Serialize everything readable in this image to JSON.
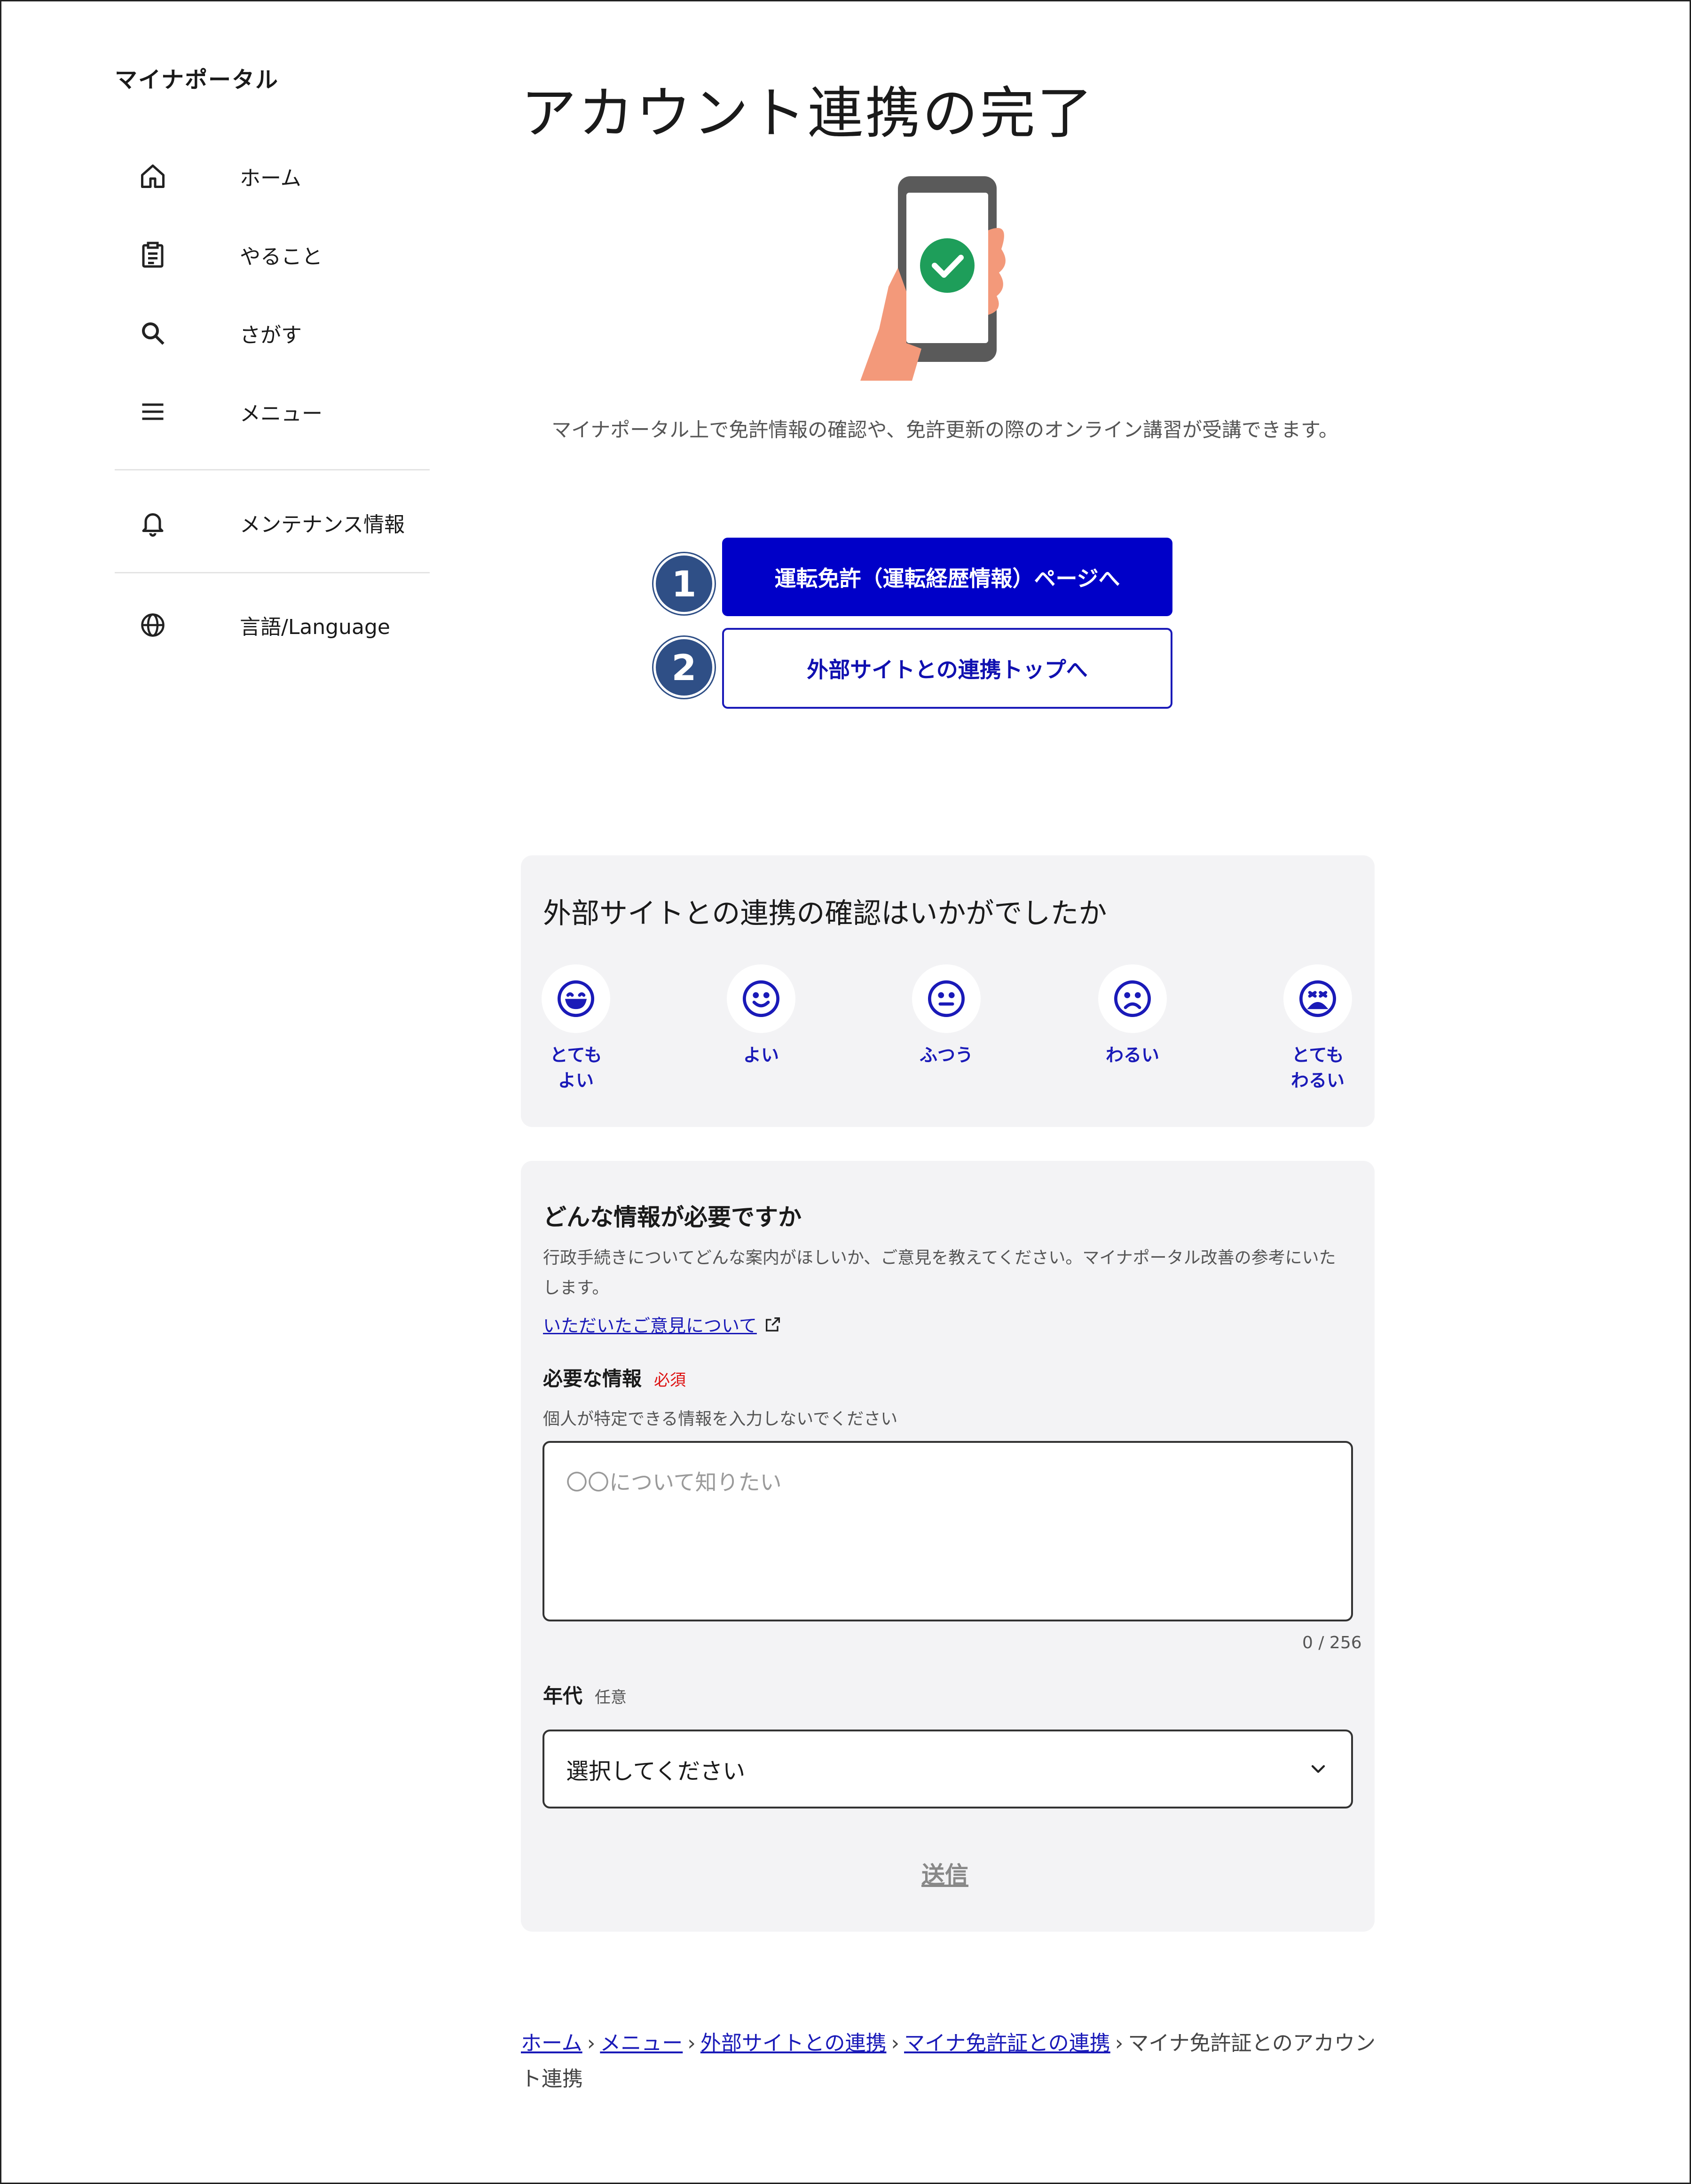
{
  "app": {
    "title": "マイナポータル"
  },
  "sidebar": {
    "items": [
      {
        "label": "ホーム",
        "icon": "home-icon"
      },
      {
        "label": "やること",
        "icon": "clipboard-icon"
      },
      {
        "label": "さがす",
        "icon": "search-icon"
      },
      {
        "label": "メニュー",
        "icon": "menu-icon"
      },
      {
        "label": "メンテナンス情報",
        "icon": "bell-icon"
      },
      {
        "label": "言語/Language",
        "icon": "globe-icon"
      }
    ]
  },
  "main": {
    "title": "アカウント連携の完了",
    "illustration": "phone-check-icon",
    "description": "マイナポータル上で免許情報の確認や、免許更新の際のオンライン講習が受講できます。",
    "buttons": {
      "primary": "運転免許（運転経歴情報）ページへ",
      "secondary": "外部サイトとの連携トップへ"
    },
    "badges": [
      "1",
      "2"
    ]
  },
  "rating": {
    "title": "外部サイトとの連携の確認はいかがでしたか",
    "options": [
      {
        "label": "とても\nよい",
        "icon": "very-happy-face-icon"
      },
      {
        "label": "よい",
        "icon": "happy-face-icon"
      },
      {
        "label": "ふつう",
        "icon": "neutral-face-icon"
      },
      {
        "label": "わるい",
        "icon": "sad-face-icon"
      },
      {
        "label": "とても\nわるい",
        "icon": "very-sad-face-icon"
      }
    ]
  },
  "feedback": {
    "title": "どんな情報が必要ですか",
    "description": "行政手続きについてどんな案内がほしいか、ご意見を教えてください。マイナポータル改善の参考にいたします。",
    "link": "いただいたご意見について",
    "required_label": "必要な情報",
    "required_tag": "必須",
    "hint": "個人が特定できる情報を入力しないでください",
    "textarea_placeholder": "〇〇について知りたい",
    "counter": "0 / 256",
    "age_label": "年代",
    "optional_tag": "任意",
    "select_value": "選択してください",
    "submit": "送信"
  },
  "breadcrumb": {
    "links": [
      "ホーム",
      "メニュー",
      "外部サイトとの連携",
      "マイナ免許証との連携"
    ],
    "current": "マイナ免許証とのアカウント連携",
    "separator": "›"
  },
  "colors": {
    "primary": "#0000c8",
    "badge": "#2f4f86",
    "success": "#1e9e5a",
    "required": "#dd1111",
    "panel": "#f3f3f5"
  }
}
